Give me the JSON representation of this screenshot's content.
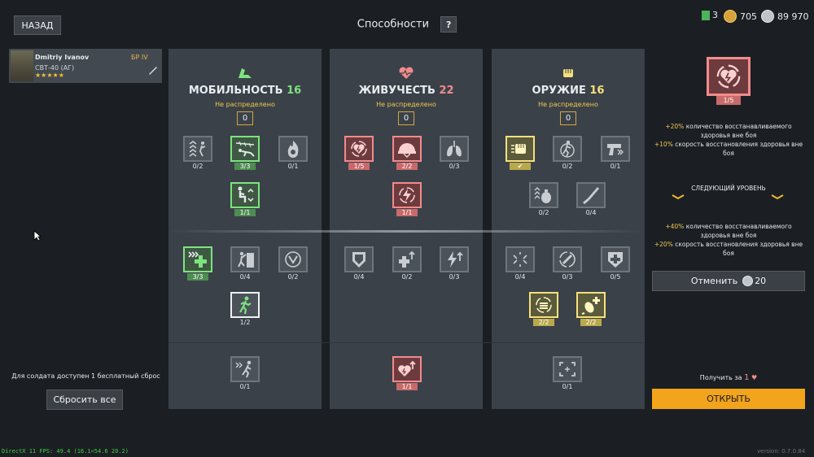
{
  "header": {
    "back_label": "НАЗАД",
    "title": "Способности",
    "help": "?"
  },
  "currency": [
    {
      "icon": "gem-icon",
      "value": "3",
      "color": "#4bb35a"
    },
    {
      "icon": "gold-coin-icon",
      "value": "705",
      "color": "#d6a23a"
    },
    {
      "icon": "silver-coin-icon",
      "value": "89 970",
      "color": "#bfc4c9"
    }
  ],
  "soldier": {
    "name": "Dmitriy Ivanov",
    "weapon": "СВТ-40 (АГ)",
    "rank": "БР IV",
    "stars": "★★★★★"
  },
  "columns": [
    {
      "title": "МОБИЛЬНОСТЬ",
      "points": "16",
      "color": "#7ee37e",
      "status": "Не распределено",
      "count": "0"
    },
    {
      "title": "ЖИВУЧЕСТЬ",
      "points": "22",
      "color": "#f28b8b",
      "status": "Не распределено",
      "count": "0"
    },
    {
      "title": "ОРУЖИЕ",
      "points": "16",
      "color": "#f7e07b",
      "status": "Не распределено",
      "count": "0"
    }
  ],
  "perks": {
    "m1": "0/2",
    "m2": "3/3",
    "m3": "0/1",
    "m4": "1/1",
    "m5": "3/3",
    "m6": "0/4",
    "m7": "0/2",
    "m8": "1/2",
    "m9": "0/1",
    "h1": "1/5",
    "h2": "2/2",
    "h3": "0/3",
    "h4": "1/1",
    "h5": "0/4",
    "h6": "0/2",
    "h7": "0/3",
    "h8": "1/1",
    "w1": "✔",
    "w2": "0/2",
    "w3": "0/1",
    "w4": "0/2",
    "w5": "0/4",
    "w6": "0/4",
    "w7": "0/3",
    "w8": "0/5",
    "w9": "2/2",
    "w10": "2/2",
    "w11": "0/1"
  },
  "detail": {
    "level": "1/5",
    "current": [
      {
        "pct": "+20%",
        "text": "количество восстанавливаемого здоровья вне боя"
      },
      {
        "pct": "+10%",
        "text": "скорость восстановления здоровья вне боя"
      }
    ],
    "next_level_label": "СЛЕДУЮЩИЙ УРОВЕНЬ",
    "next": [
      {
        "pct": "+40%",
        "text": "количество восстанавливаемого здоровья вне боя"
      },
      {
        "pct": "+20%",
        "text": "скорость восстановления здоровья вне боя"
      }
    ],
    "cancel_label": "Отменить",
    "cancel_cost": "20",
    "get_for_label": "Получить за",
    "get_for_value": "1",
    "open_label": "ОТКРЫТЬ"
  },
  "left": {
    "free_reset_text": "Для солдата доступен 1 бесплатный сброс",
    "reset_label": "Сбросить все"
  },
  "footer": {
    "fps": "DirectX 11 FPS: 49.4 (16.1<54.6 20.2)",
    "version": "version: 0.7.0.84"
  }
}
